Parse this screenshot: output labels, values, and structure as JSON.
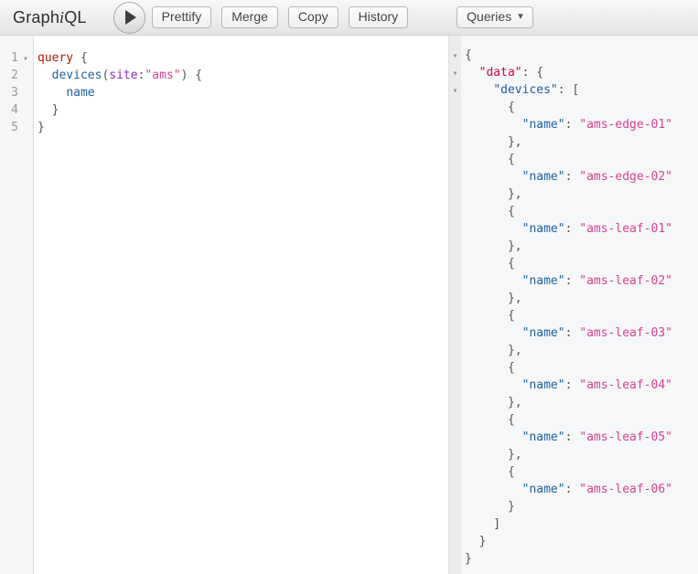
{
  "toolbar": {
    "logo": {
      "part1": "Graph",
      "part2": "i",
      "part3": "QL"
    },
    "buttons": [
      "Prettify",
      "Merge",
      "Copy",
      "History"
    ],
    "queries": {
      "label": "Queries"
    }
  },
  "icons": {
    "execute": "play",
    "fold_arrow": "▾",
    "dropdown_caret": "▾"
  },
  "syntax_colors": {
    "keyword": "#B11A04",
    "field": "#1F61A0",
    "argument": "#8B2BB9",
    "string": "#D64292",
    "top_level_key": "#D2054E",
    "punctuation": "#555555",
    "line_number": "#999999"
  },
  "editor": {
    "lines": [
      {
        "num": "1",
        "fold": true,
        "tokens": [
          [
            "kw",
            "query"
          ],
          [
            "pn",
            " {"
          ]
        ]
      },
      {
        "num": "2",
        "tokens": [
          [
            "pn",
            "  "
          ],
          [
            "prop",
            "devices"
          ],
          [
            "pn",
            "("
          ],
          [
            "attr",
            "site"
          ],
          [
            "pn",
            ":"
          ],
          [
            "str",
            "\"ams\""
          ],
          [
            "pn",
            ") {"
          ]
        ]
      },
      {
        "num": "3",
        "tokens": [
          [
            "pn",
            "    "
          ],
          [
            "prop",
            "name"
          ]
        ]
      },
      {
        "num": "4",
        "tokens": [
          [
            "pn",
            "  }"
          ]
        ]
      },
      {
        "num": "5",
        "tokens": [
          [
            "pn",
            "}"
          ]
        ]
      }
    ]
  },
  "result": {
    "lines": [
      {
        "fold": true,
        "tokens": [
          [
            "pn",
            "{"
          ]
        ]
      },
      {
        "fold": true,
        "tokens": [
          [
            "pn",
            "  "
          ],
          [
            "def",
            "\"data\""
          ],
          [
            "pn",
            ": {"
          ]
        ]
      },
      {
        "fold": true,
        "tokens": [
          [
            "pn",
            "    "
          ],
          [
            "prop",
            "\"devices\""
          ],
          [
            "pn",
            ": ["
          ]
        ]
      },
      {
        "tokens": [
          [
            "pn",
            "      {"
          ]
        ]
      },
      {
        "tokens": [
          [
            "pn",
            "        "
          ],
          [
            "prop",
            "\"name\""
          ],
          [
            "pn",
            ": "
          ],
          [
            "str",
            "\"ams-edge-01\""
          ]
        ]
      },
      {
        "tokens": [
          [
            "pn",
            "      },"
          ]
        ]
      },
      {
        "tokens": [
          [
            "pn",
            "      {"
          ]
        ]
      },
      {
        "tokens": [
          [
            "pn",
            "        "
          ],
          [
            "prop",
            "\"name\""
          ],
          [
            "pn",
            ": "
          ],
          [
            "str",
            "\"ams-edge-02\""
          ]
        ]
      },
      {
        "tokens": [
          [
            "pn",
            "      },"
          ]
        ]
      },
      {
        "tokens": [
          [
            "pn",
            "      {"
          ]
        ]
      },
      {
        "tokens": [
          [
            "pn",
            "        "
          ],
          [
            "prop",
            "\"name\""
          ],
          [
            "pn",
            ": "
          ],
          [
            "str",
            "\"ams-leaf-01\""
          ]
        ]
      },
      {
        "tokens": [
          [
            "pn",
            "      },"
          ]
        ]
      },
      {
        "tokens": [
          [
            "pn",
            "      {"
          ]
        ]
      },
      {
        "tokens": [
          [
            "pn",
            "        "
          ],
          [
            "prop",
            "\"name\""
          ],
          [
            "pn",
            ": "
          ],
          [
            "str",
            "\"ams-leaf-02\""
          ]
        ]
      },
      {
        "tokens": [
          [
            "pn",
            "      },"
          ]
        ]
      },
      {
        "tokens": [
          [
            "pn",
            "      {"
          ]
        ]
      },
      {
        "tokens": [
          [
            "pn",
            "        "
          ],
          [
            "prop",
            "\"name\""
          ],
          [
            "pn",
            ": "
          ],
          [
            "str",
            "\"ams-leaf-03\""
          ]
        ]
      },
      {
        "tokens": [
          [
            "pn",
            "      },"
          ]
        ]
      },
      {
        "tokens": [
          [
            "pn",
            "      {"
          ]
        ]
      },
      {
        "tokens": [
          [
            "pn",
            "        "
          ],
          [
            "prop",
            "\"name\""
          ],
          [
            "pn",
            ": "
          ],
          [
            "str",
            "\"ams-leaf-04\""
          ]
        ]
      },
      {
        "tokens": [
          [
            "pn",
            "      },"
          ]
        ]
      },
      {
        "tokens": [
          [
            "pn",
            "      {"
          ]
        ]
      },
      {
        "tokens": [
          [
            "pn",
            "        "
          ],
          [
            "prop",
            "\"name\""
          ],
          [
            "pn",
            ": "
          ],
          [
            "str",
            "\"ams-leaf-05\""
          ]
        ]
      },
      {
        "tokens": [
          [
            "pn",
            "      },"
          ]
        ]
      },
      {
        "tokens": [
          [
            "pn",
            "      {"
          ]
        ]
      },
      {
        "tokens": [
          [
            "pn",
            "        "
          ],
          [
            "prop",
            "\"name\""
          ],
          [
            "pn",
            ": "
          ],
          [
            "str",
            "\"ams-leaf-06\""
          ]
        ]
      },
      {
        "tokens": [
          [
            "pn",
            "      }"
          ]
        ]
      },
      {
        "tokens": [
          [
            "pn",
            "    ]"
          ]
        ]
      },
      {
        "tokens": [
          [
            "pn",
            "  }"
          ]
        ]
      },
      {
        "tokens": [
          [
            "pn",
            "}"
          ]
        ]
      }
    ]
  }
}
